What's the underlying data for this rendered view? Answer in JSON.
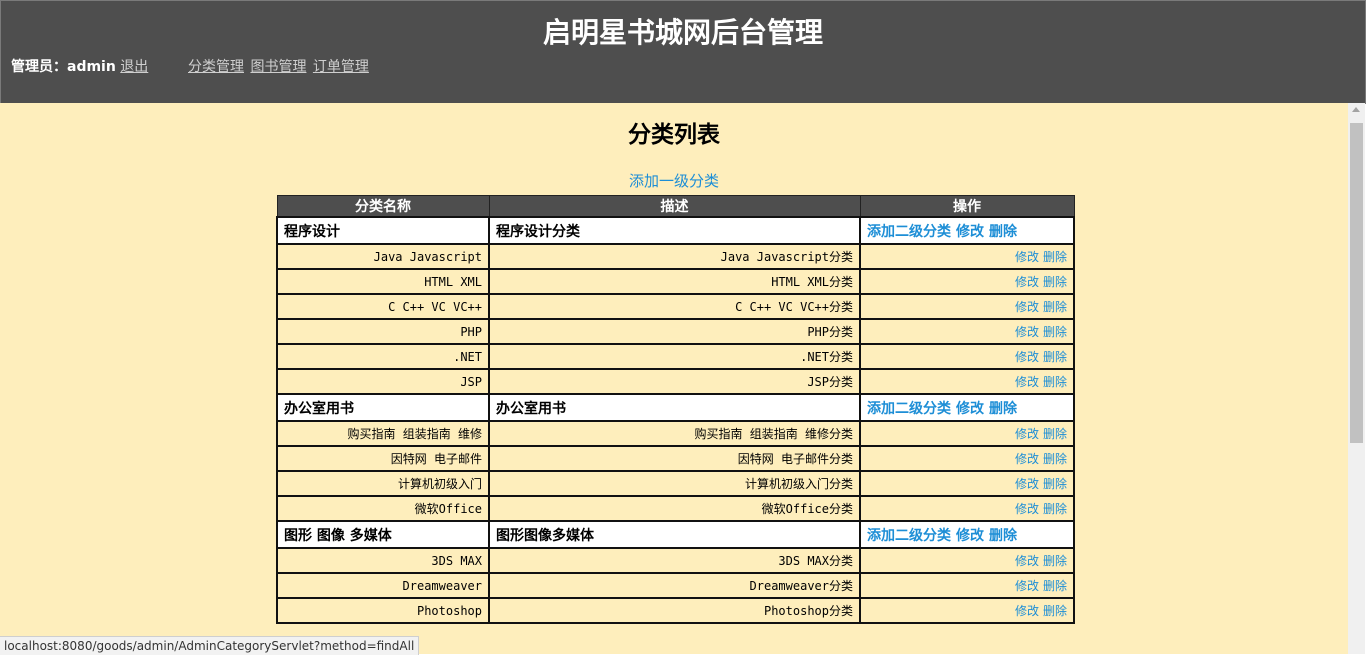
{
  "header": {
    "title": "启明星书城网后台管理",
    "admin_label": "管理员：",
    "admin_name": "admin",
    "logout": "退出",
    "nav": [
      "分类管理",
      "图书管理",
      "订单管理"
    ]
  },
  "main": {
    "title": "分类列表",
    "add_top": "添加一级分类"
  },
  "table": {
    "headers": [
      "分类名称",
      "描述",
      "操作"
    ],
    "ops": {
      "add_sub": "添加二级分类",
      "edit": "修改",
      "delete": "删除"
    }
  },
  "categories": [
    {
      "name": "程序设计",
      "desc": "程序设计分类",
      "children": [
        {
          "name": "Java Javascript",
          "desc": "Java Javascript分类"
        },
        {
          "name": "HTML XML",
          "desc": "HTML XML分类"
        },
        {
          "name": "C C++ VC VC++",
          "desc": "C C++ VC VC++分类"
        },
        {
          "name": "PHP",
          "desc": "PHP分类"
        },
        {
          "name": ".NET",
          "desc": ".NET分类"
        },
        {
          "name": "JSP",
          "desc": "JSP分类"
        }
      ]
    },
    {
      "name": "办公室用书",
      "desc": "办公室用书",
      "children": [
        {
          "name": "购买指南 组装指南 维修",
          "desc": "购买指南 组装指南 维修分类"
        },
        {
          "name": "因特网 电子邮件",
          "desc": "因特网 电子邮件分类"
        },
        {
          "name": "计算机初级入门",
          "desc": "计算机初级入门分类"
        },
        {
          "name": "微软Office",
          "desc": "微软Office分类"
        }
      ]
    },
    {
      "name": "图形 图像 多媒体",
      "desc": "图形图像多媒体",
      "children": [
        {
          "name": "3DS MAX",
          "desc": "3DS MAX分类"
        },
        {
          "name": "Dreamweaver",
          "desc": "Dreamweaver分类"
        },
        {
          "name": "Photoshop",
          "desc": "Photoshop分类"
        }
      ]
    }
  ],
  "status_bar": {
    "url": "localhost:8080/goods/admin/AdminCategoryServlet?method=findAll"
  },
  "colors": {
    "header_bg": "#4e4e4e",
    "content_bg": "#feeebc",
    "link": "#1d8ed6"
  }
}
